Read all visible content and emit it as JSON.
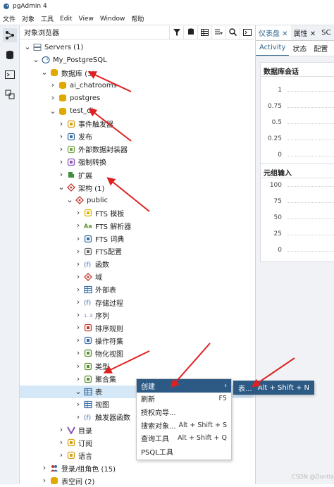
{
  "window": {
    "title": "pgAdmin 4"
  },
  "menu": [
    "文件",
    "对象",
    "工具",
    "Edit",
    "View",
    "Window",
    "帮助"
  ],
  "browser": {
    "title": "对象浏览器",
    "tree": [
      {
        "label": "Servers (1)",
        "depth": 0,
        "exp": "v",
        "icon": "servers-icon",
        "color": "#6b7b8c"
      },
      {
        "label": "My_PostgreSQL",
        "depth": 1,
        "exp": "v",
        "icon": "elephant-icon",
        "color": "#336791"
      },
      {
        "label": "数据库 (3)",
        "depth": 2,
        "exp": "v",
        "icon": "databases-icon",
        "color": "#e0a800"
      },
      {
        "label": "ai_chatrooms",
        "depth": 3,
        "exp": ">",
        "icon": "database-icon",
        "color": "#e0a800"
      },
      {
        "label": "postgres",
        "depth": 3,
        "exp": ">",
        "icon": "database-icon",
        "color": "#e0a800"
      },
      {
        "label": "test_db",
        "depth": 3,
        "exp": "v",
        "icon": "database-icon",
        "color": "#e0a800"
      },
      {
        "label": "事件触发器",
        "depth": 4,
        "exp": ">",
        "icon": "event-trigger-icon",
        "color": "#d4a017"
      },
      {
        "label": "发布",
        "depth": 4,
        "exp": ">",
        "icon": "publication-icon",
        "color": "#3b6ea5"
      },
      {
        "label": "外部数据封装器",
        "depth": 4,
        "exp": ">",
        "icon": "fdw-icon",
        "color": "#7aa84c"
      },
      {
        "label": "强制转换",
        "depth": 4,
        "exp": ">",
        "icon": "cast-icon",
        "color": "#8a56b5"
      },
      {
        "label": "扩展",
        "depth": 4,
        "exp": ">",
        "icon": "extension-icon",
        "color": "#3f8f3f"
      },
      {
        "label": "架构 (1)",
        "depth": 4,
        "exp": "v",
        "icon": "schemas-icon",
        "color": "#c0392b"
      },
      {
        "label": "public",
        "depth": 5,
        "exp": "v",
        "icon": "schema-icon",
        "color": "#c0392b"
      },
      {
        "label": "FTS 模板",
        "depth": 6,
        "exp": ">",
        "icon": "fts-template-icon",
        "color": "#e0b400"
      },
      {
        "label": "FTS 解析器",
        "depth": 6,
        "exp": ">",
        "icon": "fts-parser-icon",
        "color": "#5a8f2f"
      },
      {
        "label": "FTS 词典",
        "depth": 6,
        "exp": ">",
        "icon": "fts-dictionary-icon",
        "color": "#3b6ea5"
      },
      {
        "label": "FTS配置",
        "depth": 6,
        "exp": ">",
        "icon": "fts-config-icon",
        "color": "#666666"
      },
      {
        "label": "函数",
        "depth": 6,
        "exp": ">",
        "icon": "function-icon",
        "color": "#3b6ea5"
      },
      {
        "label": "域",
        "depth": 6,
        "exp": ">",
        "icon": "domain-icon",
        "color": "#c0392b"
      },
      {
        "label": "外部表",
        "depth": 6,
        "exp": ">",
        "icon": "foreign-table-icon",
        "color": "#3b6ea5"
      },
      {
        "label": "存储过程",
        "depth": 6,
        "exp": ">",
        "icon": "procedure-icon",
        "color": "#3b6ea5"
      },
      {
        "label": "序列",
        "depth": 6,
        "exp": ">",
        "icon": "sequence-icon",
        "color": "#8a56b5"
      },
      {
        "label": "排序规则",
        "depth": 6,
        "exp": ">",
        "icon": "collation-icon",
        "color": "#c0392b"
      },
      {
        "label": "操作符集",
        "depth": 6,
        "exp": ">",
        "icon": "operator-icon",
        "color": "#3b6ea5"
      },
      {
        "label": "物化视图",
        "depth": 6,
        "exp": ">",
        "icon": "mview-icon",
        "color": "#5a8f2f"
      },
      {
        "label": "类型",
        "depth": 6,
        "exp": ">",
        "icon": "type-icon",
        "color": "#5a8f2f"
      },
      {
        "label": "聚合集",
        "depth": 6,
        "exp": ">",
        "icon": "aggregate-icon",
        "color": "#5a8f2f"
      },
      {
        "label": "表",
        "depth": 6,
        "exp": "v",
        "icon": "tables-icon",
        "color": "#3b6ea5",
        "selected": true
      },
      {
        "label": "视图",
        "depth": 6,
        "exp": ">",
        "icon": "view-icon",
        "color": "#3b6ea5"
      },
      {
        "label": "触发器函数",
        "depth": 6,
        "exp": ">",
        "icon": "trigger-function-icon",
        "color": "#3b6ea5"
      },
      {
        "label": "目录",
        "depth": 4,
        "exp": ">",
        "icon": "catalog-icon",
        "color": "#8a56b5"
      },
      {
        "label": "订阅",
        "depth": 4,
        "exp": ">",
        "icon": "subscription-icon",
        "color": "#d4a017"
      },
      {
        "label": "语言",
        "depth": 4,
        "exp": ">",
        "icon": "language-icon",
        "color": "#d4a017"
      },
      {
        "label": "登录/组角色 (15)",
        "depth": 2,
        "exp": ">",
        "icon": "roles-icon",
        "color": "#c0392b"
      },
      {
        "label": "表空间 (2)",
        "depth": 2,
        "exp": ">",
        "icon": "tablespace-icon",
        "color": "#e0a800"
      }
    ]
  },
  "dashboard": {
    "tabs": [
      "仪表盘 ✕",
      "属性 ✕",
      "SC"
    ],
    "subtabs": [
      "Activity",
      "状态",
      "配置"
    ],
    "sessions_title": "数据库会话",
    "sessions_ticks": [
      "1",
      "0.75",
      "0.5",
      "0.25",
      "0"
    ],
    "tuples_title": "元组输入",
    "tuples_ticks": [
      "100",
      "75",
      "50",
      "25",
      "0"
    ]
  },
  "context_menu": {
    "items": [
      {
        "label": "创建",
        "shortcut": "›",
        "highlight": true
      },
      {
        "label": "刷新",
        "shortcut": "F5"
      },
      {
        "label": "授权向导...",
        "shortcut": ""
      },
      {
        "label": "搜索对象...",
        "shortcut": "Alt + Shift + S"
      },
      {
        "label": "查询工具",
        "shortcut": "Alt + Shift + Q"
      },
      {
        "label": "PSQL工具",
        "shortcut": ""
      }
    ],
    "submenu": {
      "label": "表...",
      "shortcut": "Alt + Shift + N"
    }
  },
  "watermark": "CSDN @Dontla",
  "accent_color": "#2c5a85",
  "annotation_color": "#e02020"
}
